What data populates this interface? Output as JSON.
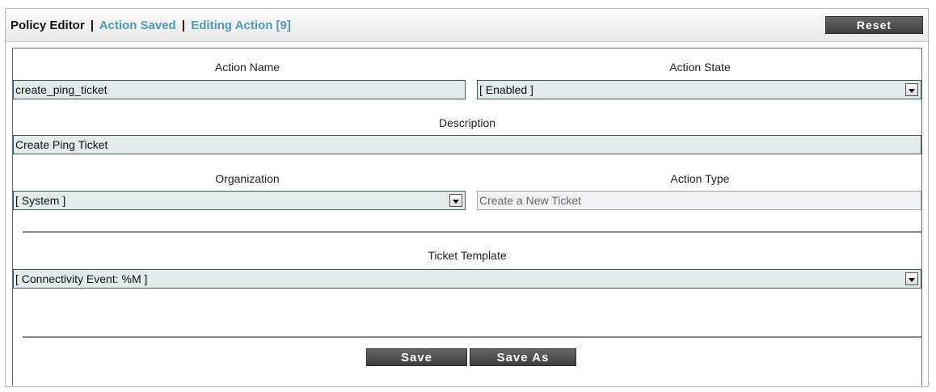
{
  "header": {
    "title": "Policy Editor",
    "separator": "|",
    "status_saved": "Action Saved",
    "status_editing": "Editing Action [9]",
    "reset_label": "Reset"
  },
  "form": {
    "action_name": {
      "label": "Action Name",
      "value": "create_ping_ticket"
    },
    "action_state": {
      "label": "Action State",
      "value": "[ Enabled ]"
    },
    "description": {
      "label": "Description",
      "value": "Create Ping Ticket"
    },
    "organization": {
      "label": "Organization",
      "value": "[ System ]"
    },
    "action_type": {
      "label": "Action Type",
      "value": "Create a New Ticket"
    },
    "ticket_template": {
      "label": "Ticket Template",
      "value": "[ Connectivity Event: %M ]"
    }
  },
  "footer": {
    "save_label": "Save",
    "save_as_label": "Save As"
  },
  "icons": {
    "dropdown": "chevron-down-icon"
  }
}
